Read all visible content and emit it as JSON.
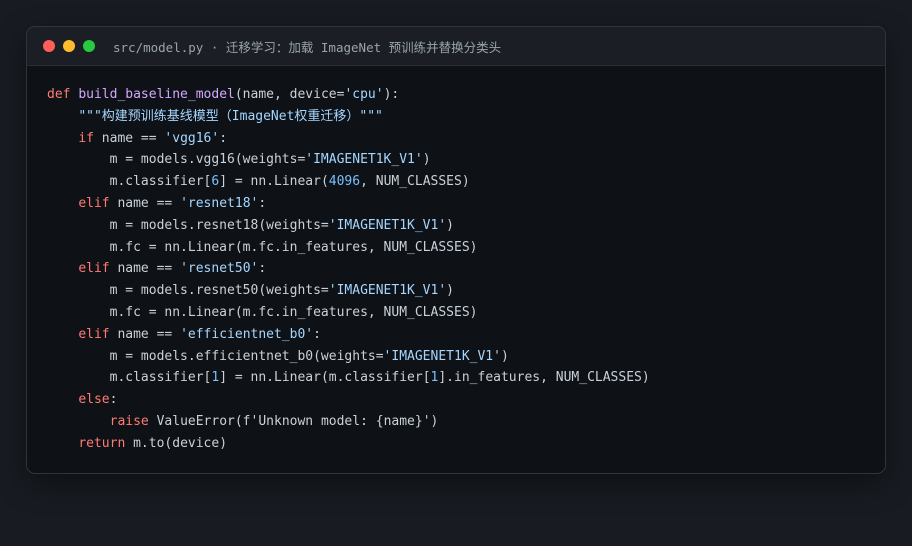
{
  "window": {
    "title": "src/model.py · 迁移学习：加载 ImageNet 预训练并替换分类头"
  },
  "code_lines": [
    [
      {
        "t": "def",
        "c": "kw"
      },
      {
        "t": " ",
        "c": "plain"
      },
      {
        "t": "build_baseline_model",
        "c": "fn"
      },
      {
        "t": "(name, device=",
        "c": "plain"
      },
      {
        "t": "'cpu'",
        "c": "str"
      },
      {
        "t": "):",
        "c": "plain"
      }
    ],
    [
      {
        "t": "    ",
        "c": "plain"
      },
      {
        "t": "\"\"\"构建预训练基线模型（ImageNet权重迁移）\"\"\"",
        "c": "doc"
      }
    ],
    [
      {
        "t": "    ",
        "c": "plain"
      },
      {
        "t": "if",
        "c": "kw"
      },
      {
        "t": " name == ",
        "c": "plain"
      },
      {
        "t": "'vgg16'",
        "c": "str"
      },
      {
        "t": ":",
        "c": "plain"
      }
    ],
    [
      {
        "t": "        m = models.vgg16(weights=",
        "c": "plain"
      },
      {
        "t": "'IMAGENET1K_V1'",
        "c": "str"
      },
      {
        "t": ")",
        "c": "plain"
      }
    ],
    [
      {
        "t": "        m.classifier[",
        "c": "plain"
      },
      {
        "t": "6",
        "c": "num"
      },
      {
        "t": "] = nn.Linear(",
        "c": "plain"
      },
      {
        "t": "4096",
        "c": "num"
      },
      {
        "t": ", NUM_CLASSES)",
        "c": "plain"
      }
    ],
    [
      {
        "t": "    ",
        "c": "plain"
      },
      {
        "t": "elif",
        "c": "kw"
      },
      {
        "t": " name == ",
        "c": "plain"
      },
      {
        "t": "'resnet18'",
        "c": "str"
      },
      {
        "t": ":",
        "c": "plain"
      }
    ],
    [
      {
        "t": "        m = models.resnet18(weights=",
        "c": "plain"
      },
      {
        "t": "'IMAGENET1K_V1'",
        "c": "str"
      },
      {
        "t": ")",
        "c": "plain"
      }
    ],
    [
      {
        "t": "        m.fc = nn.Linear(m.fc.in_features, NUM_CLASSES)",
        "c": "plain"
      }
    ],
    [
      {
        "t": "    ",
        "c": "plain"
      },
      {
        "t": "elif",
        "c": "kw"
      },
      {
        "t": " name == ",
        "c": "plain"
      },
      {
        "t": "'resnet50'",
        "c": "str"
      },
      {
        "t": ":",
        "c": "plain"
      }
    ],
    [
      {
        "t": "        m = models.resnet50(weights=",
        "c": "plain"
      },
      {
        "t": "'IMAGENET1K_V1'",
        "c": "str"
      },
      {
        "t": ")",
        "c": "plain"
      }
    ],
    [
      {
        "t": "        m.fc = nn.Linear(m.fc.in_features, NUM_CLASSES)",
        "c": "plain"
      }
    ],
    [
      {
        "t": "    ",
        "c": "plain"
      },
      {
        "t": "elif",
        "c": "kw"
      },
      {
        "t": " name == ",
        "c": "plain"
      },
      {
        "t": "'efficientnet_b0'",
        "c": "str"
      },
      {
        "t": ":",
        "c": "plain"
      }
    ],
    [
      {
        "t": "        m = models.efficientnet_b0(weights=",
        "c": "plain"
      },
      {
        "t": "'IMAGENET1K_V1'",
        "c": "str"
      },
      {
        "t": ")",
        "c": "plain"
      }
    ],
    [
      {
        "t": "        m.classifier[",
        "c": "plain"
      },
      {
        "t": "1",
        "c": "num"
      },
      {
        "t": "] = nn.Linear(m.classifier[",
        "c": "plain"
      },
      {
        "t": "1",
        "c": "num"
      },
      {
        "t": "].in_features, NUM_CLASSES)",
        "c": "plain"
      }
    ],
    [
      {
        "t": "    ",
        "c": "plain"
      },
      {
        "t": "else",
        "c": "kw"
      },
      {
        "t": ":",
        "c": "plain"
      }
    ],
    [
      {
        "t": "        ",
        "c": "plain"
      },
      {
        "t": "raise",
        "c": "kw"
      },
      {
        "t": " ValueError(f'Unknown model: {name}')",
        "c": "plain"
      }
    ],
    [
      {
        "t": "    ",
        "c": "plain"
      },
      {
        "t": "return",
        "c": "kw"
      },
      {
        "t": " m.to(device)",
        "c": "plain"
      }
    ]
  ]
}
